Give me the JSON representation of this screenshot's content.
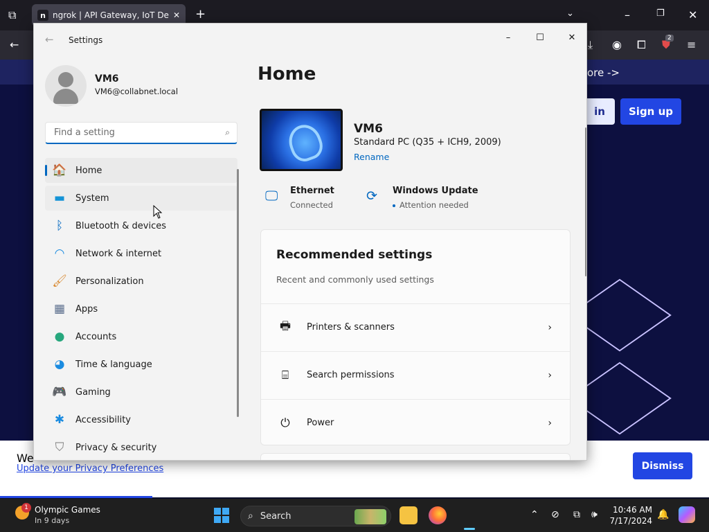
{
  "browser": {
    "tab_title": "ngrok | API Gateway, IoT Device",
    "tab_favicon": "n",
    "ext_badge": "2"
  },
  "site": {
    "banner_text": "ore ->",
    "login_label": "in",
    "signup_label": "Sign up",
    "cookie_lead": "We",
    "cookie_link": "Update your Privacy Preferences",
    "dismiss_label": "Dismiss"
  },
  "settings": {
    "window_title": "Settings",
    "user": {
      "name": "VM6",
      "email": "VM6@collabnet.local"
    },
    "search_placeholder": "Find a setting",
    "nav": [
      {
        "label": "Home",
        "icon": "home-icon",
        "glyph": "🏠",
        "color": "#e8743b"
      },
      {
        "label": "System",
        "icon": "system-icon",
        "glyph": "▬",
        "color": "#1493d6"
      },
      {
        "label": "Bluetooth & devices",
        "icon": "bluetooth-icon",
        "glyph": "ᛒ",
        "color": "#0067c0"
      },
      {
        "label": "Network & internet",
        "icon": "wifi-icon",
        "glyph": "◠",
        "color": "#1a8be0"
      },
      {
        "label": "Personalization",
        "icon": "brush-icon",
        "glyph": "🖌",
        "color": "#d98b34"
      },
      {
        "label": "Apps",
        "icon": "apps-icon",
        "glyph": "▦",
        "color": "#5a6d8c"
      },
      {
        "label": "Accounts",
        "icon": "accounts-icon",
        "glyph": "●",
        "color": "#27a77d"
      },
      {
        "label": "Time & language",
        "icon": "globe-clock-icon",
        "glyph": "◕",
        "color": "#1a8be0"
      },
      {
        "label": "Gaming",
        "icon": "gamepad-icon",
        "glyph": "🎮",
        "color": "#7a7a7a"
      },
      {
        "label": "Accessibility",
        "icon": "accessibility-icon",
        "glyph": "✱",
        "color": "#1a8be0"
      },
      {
        "label": "Privacy & security",
        "icon": "shield-icon",
        "glyph": "⛉",
        "color": "#7a7a7a"
      }
    ],
    "home": {
      "title": "Home",
      "device_name": "VM6",
      "device_model": "Standard PC (Q35 + ICH9, 2009)",
      "rename_label": "Rename",
      "ethernet_title": "Ethernet",
      "ethernet_status": "Connected",
      "update_title": "Windows Update",
      "update_status": "Attention needed",
      "rec_title": "Recommended settings",
      "rec_subtitle": "Recent and commonly used settings",
      "rec_items": [
        {
          "label": "Printers & scanners",
          "icon": "printer-icon"
        },
        {
          "label": "Search permissions",
          "icon": "search-permissions-icon"
        },
        {
          "label": "Power",
          "icon": "power-icon"
        }
      ]
    }
  },
  "taskbar": {
    "weather_badge": "1",
    "weather_title": "Olympic Games",
    "weather_sub": "In 9 days",
    "search_label": "Search",
    "time": "10:46 AM",
    "date": "7/17/2024"
  }
}
